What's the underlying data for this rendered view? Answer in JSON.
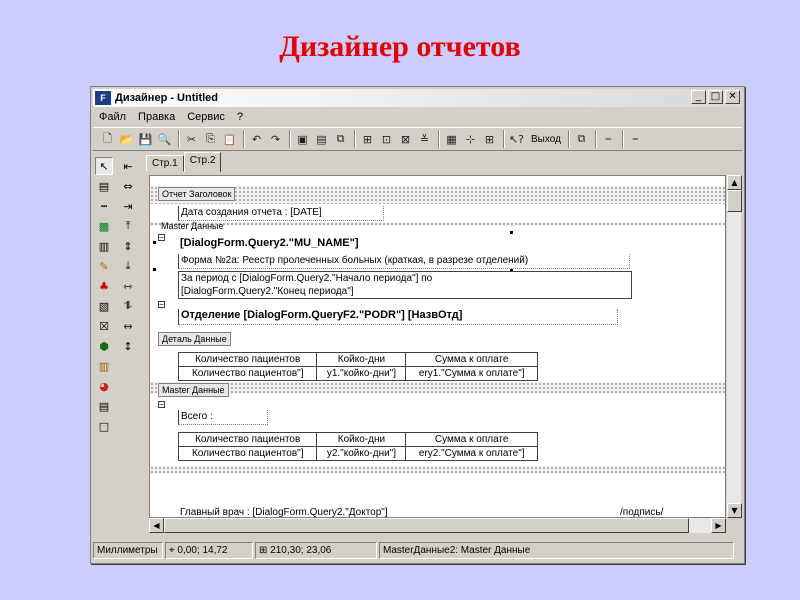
{
  "slide_title": "Дизайнер отчетов",
  "window": {
    "title": "Дизайнер - Untitled",
    "buttons": {
      "minimize": "_",
      "maximize": "□",
      "close": "✕"
    }
  },
  "menu": [
    "Файл",
    "Правка",
    "Сервис",
    "?"
  ],
  "toolbar": {
    "exit_label": "Выход"
  },
  "tabs": [
    "Стр.1",
    "Стр.2"
  ],
  "active_tab": "Стр.2",
  "bands": {
    "report_header": "Отчет Заголовок",
    "master_data_1": "Master Данные",
    "detail_data": "Деталь Данные",
    "master_data_2": "Master Данные"
  },
  "fields": {
    "created_date": "Дата создания отчета : [DATE]",
    "mu_name": "[DialogForm.Query2.\"MU_NAME\"]",
    "form_title": "Форма №2а: Реестр пролеченных больных (краткая, в разрезе отделений)",
    "period_line1": "За период с [DialogForm.Query2.\"Начало периода\"] по",
    "period_line2": "[DialogForm.Query2.\"Конец периода\"]",
    "department": "Отделение [DialogForm.QueryF2.\"PODR\"] [НазвОтд]",
    "total": "Всего :",
    "chief_doctor": "Главный врач : [DialogForm.Query2.\"Доктор\"]",
    "signature": "/подпись/"
  },
  "table1": {
    "headers": [
      "Количество пациентов",
      "Койко-дни",
      "Сумма к оплате"
    ],
    "row": [
      "Количество пациентов\"]",
      "y1.\"койко-дни\"]",
      "ery1.\"Сумма к оплате\"]"
    ]
  },
  "table2": {
    "headers": [
      "Количество пациентов",
      "Койко-дни",
      "Сумма к оплате"
    ],
    "row": [
      "Количество пациентов\"]",
      "y2.\"койко-дни\"]",
      "ery2.\"Сумма к оплате\"]"
    ]
  },
  "status": {
    "units": "Миллиметры",
    "position": "0,00; 14,72",
    "size": "210,30; 23,06",
    "object": "MasterДанные2: Master Данные"
  }
}
